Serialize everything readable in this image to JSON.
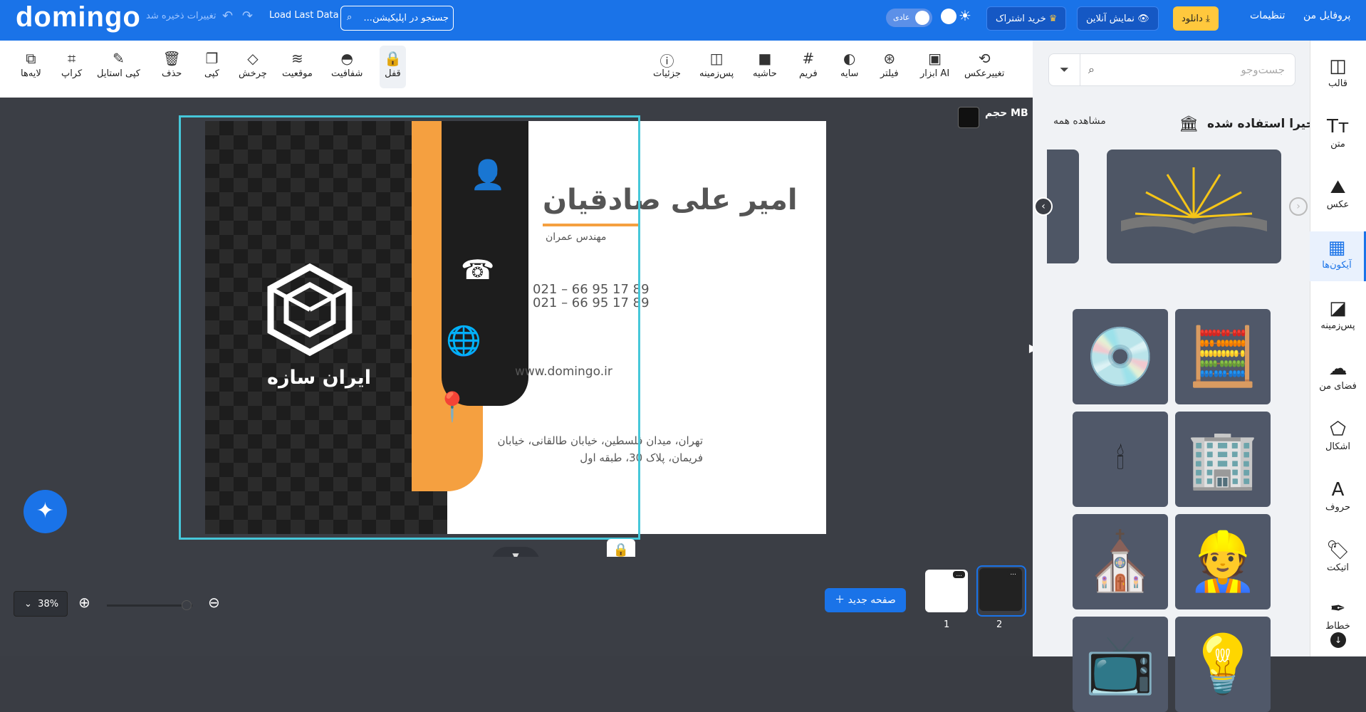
{
  "topbar": {
    "logo": "domingo",
    "saved_status": "تغییرات ذخیره شد",
    "load_last": "Load Last Data",
    "search_app": "جستجو در اپلیکیشن...",
    "profile": "پروفایل من",
    "settings": "تنظیمات",
    "download": "دانلود",
    "preview": "نمایش آنلاین",
    "subscribe": "خرید اشتراک",
    "mode": "عادی",
    "accent": "#1a73e8"
  },
  "toolbar": {
    "items": [
      {
        "label": "تغییرعکس",
        "icon": "swap-image-icon"
      },
      {
        "label": "ابزار AI",
        "icon": "ai-tools-icon"
      },
      {
        "label": "فیلتر",
        "icon": "filter-icon"
      },
      {
        "label": "سایه",
        "icon": "shadow-icon"
      },
      {
        "label": "فریم",
        "icon": "frame-icon"
      },
      {
        "label": "حاشیه",
        "icon": "border-icon"
      },
      {
        "label": "پس‌زمینه",
        "icon": "background-icon"
      },
      {
        "label": "جزئیات",
        "icon": "info-icon"
      },
      {
        "label": "قفل",
        "icon": "lock-icon"
      },
      {
        "label": "شفافیت",
        "icon": "opacity-icon"
      },
      {
        "label": "موقعیت",
        "icon": "layers-position-icon"
      },
      {
        "label": "چرخش",
        "icon": "rotate-icon"
      },
      {
        "label": "کپی",
        "icon": "copy-icon"
      },
      {
        "label": "حذف",
        "icon": "trash-icon"
      },
      {
        "label": "کپی استایل",
        "icon": "brush-icon"
      },
      {
        "label": "کراپ",
        "icon": "crop-icon"
      },
      {
        "label": "لایه‌ها",
        "icon": "layers-icon"
      }
    ]
  },
  "canvas": {
    "size_label": "حجم MB",
    "card": {
      "name": "امیر علی صادقیان",
      "job": "مهندس عمران",
      "phone1": "021 – 66 95 17 89",
      "phone2": "021 – 66 95 17 89",
      "website": "www.domingo.ir",
      "address1": "تهران، میدان فلسطین، خیابان طالقانی، خیابان",
      "address2": "فریمان، پلاک 30، طبقه اول",
      "brand": "ایران سازه"
    }
  },
  "bottom": {
    "zoom": "38%",
    "new_page": "صفحه جدید",
    "pages": [
      "1",
      "2"
    ],
    "thumb_menu": "..."
  },
  "panel": {
    "search_placeholder": "جست‌وجو",
    "recent_title": "اخیرا استفاده شده",
    "see_all": "مشاهده همه"
  },
  "rail": [
    {
      "label": "قالب",
      "icon": "template-icon"
    },
    {
      "label": "متن",
      "icon": "text-icon"
    },
    {
      "label": "عکس",
      "icon": "image-icon"
    },
    {
      "label": "آیکون‌ها",
      "icon": "icons-grid-icon"
    },
    {
      "label": "پس‌زمینه",
      "icon": "background-icon"
    },
    {
      "label": "فضای من",
      "icon": "cloud-upload-icon"
    },
    {
      "label": "اشکال",
      "icon": "shapes-icon"
    },
    {
      "label": "حروف",
      "icon": "letters-icon"
    },
    {
      "label": "اتیکت",
      "icon": "tag-icon"
    },
    {
      "label": "خطاط",
      "icon": "calligraphy-icon"
    }
  ]
}
